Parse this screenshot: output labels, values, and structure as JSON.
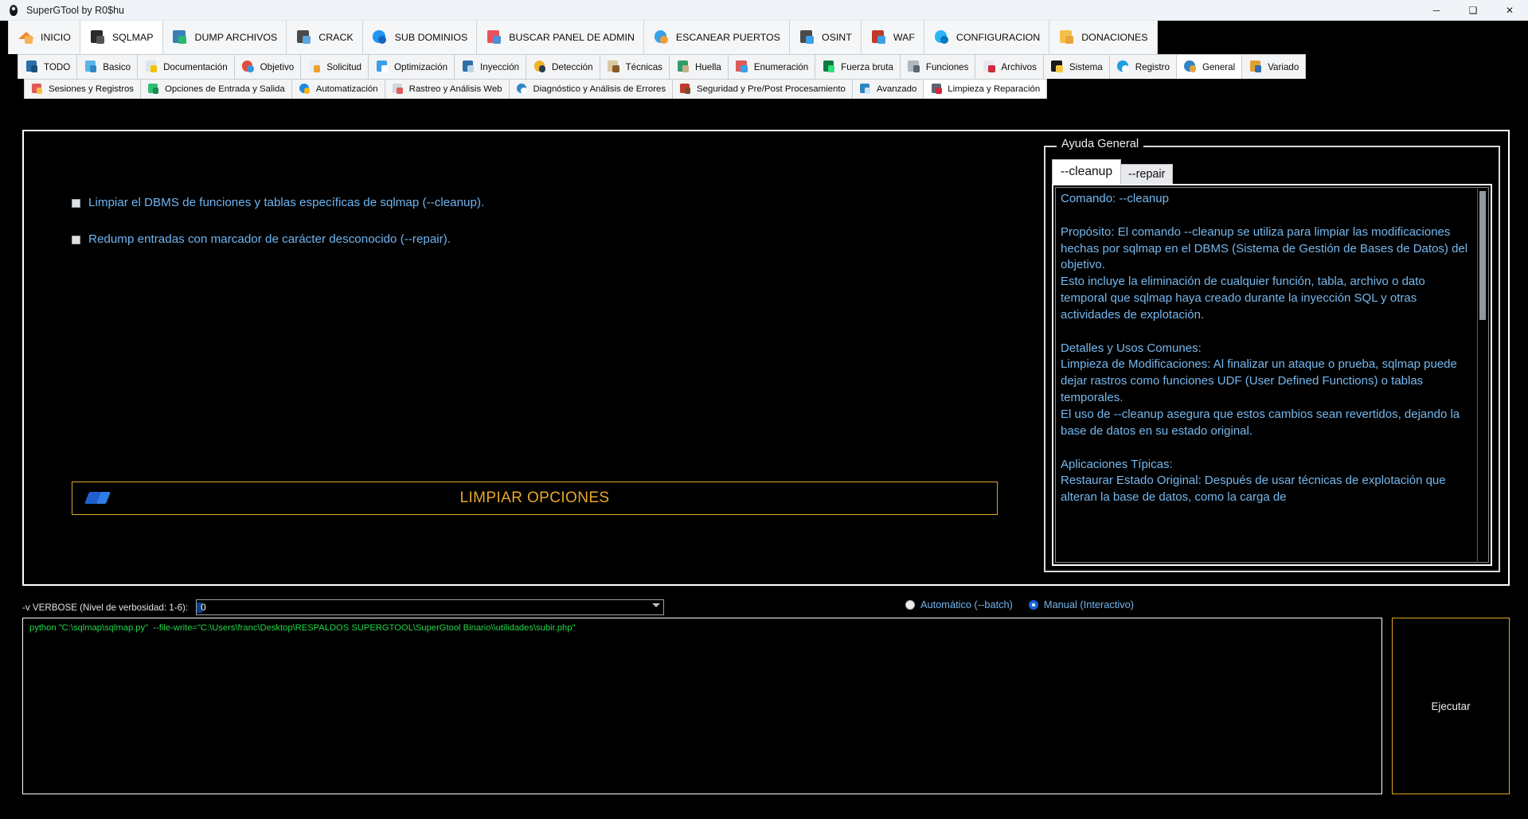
{
  "window": {
    "title": "SuperGTool by R0$hu",
    "minimize": "─",
    "maximize": "❑",
    "close": "✕"
  },
  "mainnav": {
    "items": [
      {
        "label": "INICIO",
        "icon": "home-icon",
        "active": false
      },
      {
        "label": "SQLMAP",
        "icon": "terminal-icon",
        "active": true
      },
      {
        "label": "DUMP ARCHIVOS",
        "icon": "database-download-icon",
        "active": false
      },
      {
        "label": "CRACK",
        "icon": "unlock-icon",
        "active": false
      },
      {
        "label": "SUB DOMINIOS",
        "icon": "globe-network-icon",
        "active": false
      },
      {
        "label": "BUSCAR PANEL DE ADMIN",
        "icon": "admin-panel-icon",
        "active": false
      },
      {
        "label": "ESCANEAR PUERTOS",
        "icon": "port-scan-icon",
        "active": false
      },
      {
        "label": "OSINT",
        "icon": "padlock-open-icon",
        "active": false
      },
      {
        "label": "WAF",
        "icon": "firewall-brick-icon",
        "active": false
      },
      {
        "label": "CONFIGURACION",
        "icon": "gear-icon",
        "active": false
      },
      {
        "label": "DONACIONES",
        "icon": "donate-box-icon",
        "active": false
      }
    ]
  },
  "tabrow2": {
    "items": [
      {
        "label": "TODO",
        "icon": "user-hood-icon",
        "active": false
      },
      {
        "label": "Basico",
        "icon": "robot-icon",
        "active": false
      },
      {
        "label": "Documentación",
        "icon": "sql-document-icon",
        "active": false
      },
      {
        "label": "Objetivo",
        "icon": "target-icon",
        "active": false
      },
      {
        "label": "Solicitud",
        "icon": "request-form-icon",
        "active": false
      },
      {
        "label": "Optimización",
        "icon": "speed-gauge-icon",
        "active": false
      },
      {
        "label": "Inyección",
        "icon": "injection-icon",
        "active": false
      },
      {
        "label": "Detección",
        "icon": "detection-icon",
        "active": false
      },
      {
        "label": "Técnicas",
        "icon": "techniques-icon",
        "active": false
      },
      {
        "label": "Huella",
        "icon": "fingerprint-icon",
        "active": false
      },
      {
        "label": "Enumeración",
        "icon": "enumeration-icon",
        "active": false
      },
      {
        "label": "Fuerza bruta",
        "icon": "binary-icon",
        "active": false
      },
      {
        "label": "Funciones",
        "icon": "functions-icon",
        "active": false
      },
      {
        "label": "Archivos",
        "icon": "file-red-icon",
        "active": false
      },
      {
        "label": "Sistema",
        "icon": "linux-penguin-icon",
        "active": false
      },
      {
        "label": "Registro",
        "icon": "registry-icon",
        "active": false
      },
      {
        "label": "General",
        "icon": "general-globe-icon",
        "active": true
      },
      {
        "label": "Variado",
        "icon": "misc-icon",
        "active": false
      }
    ]
  },
  "tabrow3": {
    "items": [
      {
        "label": "Sesiones y Registros",
        "icon": "sessions-logs-icon",
        "active": false
      },
      {
        "label": "Opciones de Entrada y Salida",
        "icon": "io-arrows-icon",
        "active": false
      },
      {
        "label": "Automatización",
        "icon": "automation-icon",
        "active": false
      },
      {
        "label": "Rastreo y Análisis Web",
        "icon": "web-crawl-icon",
        "active": false
      },
      {
        "label": "Diagnóstico y Análisis de Errores",
        "icon": "diagnostics-icon",
        "active": false
      },
      {
        "label": "Seguridad y Pre/Post Procesamiento",
        "icon": "security-wall-icon",
        "active": false
      },
      {
        "label": "Avanzado",
        "icon": "advanced-icon",
        "active": false
      },
      {
        "label": "Limpieza y Reparación",
        "icon": "tools-repair-icon",
        "active": true
      }
    ]
  },
  "options": {
    "checkboxes": [
      {
        "label": "Limpiar el DBMS de funciones y tablas específicas de sqlmap (--cleanup).",
        "checked": false
      },
      {
        "label": "Redump entradas con marcador de carácter desconocido (--repair).",
        "checked": false
      }
    ],
    "clear_button": "LIMPIAR OPCIONES"
  },
  "help": {
    "legend": "Ayuda General",
    "tabs": [
      {
        "label": "--cleanup",
        "active": true
      },
      {
        "label": "--repair",
        "active": false
      }
    ],
    "body": "Comando: --cleanup\n\nPropósito: El comando --cleanup se utiliza para limpiar las modificaciones hechas por sqlmap en el DBMS (Sistema de Gestión de Bases de Datos) del objetivo.\nEsto incluye la eliminación de cualquier función, tabla, archivo o dato temporal que sqlmap haya creado durante la inyección SQL y otras actividades de explotación.\n\nDetalles y Usos Comunes:\nLimpieza de Modificaciones: Al finalizar un ataque o prueba, sqlmap puede dejar rastros como funciones UDF (User Defined Functions) o tablas temporales.\nEl uso de --cleanup asegura que estos cambios sean revertidos, dejando la base de datos en su estado original.\n\nAplicaciones Típicas:\nRestaurar Estado Original: Después de usar técnicas de explotación que alteran la base de datos, como la carga de"
  },
  "footer": {
    "verbose_label": "-v VERBOSE (Nivel de verbosidad: 1-6):",
    "verbose_value": "0",
    "modes": [
      {
        "label": "Automático (--batch)",
        "selected": false
      },
      {
        "label": "Manual (Interactivo)",
        "selected": true
      }
    ],
    "console_command": "python \"C:\\sqlmap\\sqlmap.py\"  --file-write=\"C:\\Users\\franc\\Desktop\\RESPALDOS SUPERGTOOL\\SuperGtool Binario\\\\utilidades\\subir.php\"",
    "execute_label": "Ejecutar"
  },
  "colors": {
    "accent_gold": "#e0a526",
    "link_blue": "#74b6ef",
    "console_green": "#20d848",
    "background": "#000000"
  }
}
